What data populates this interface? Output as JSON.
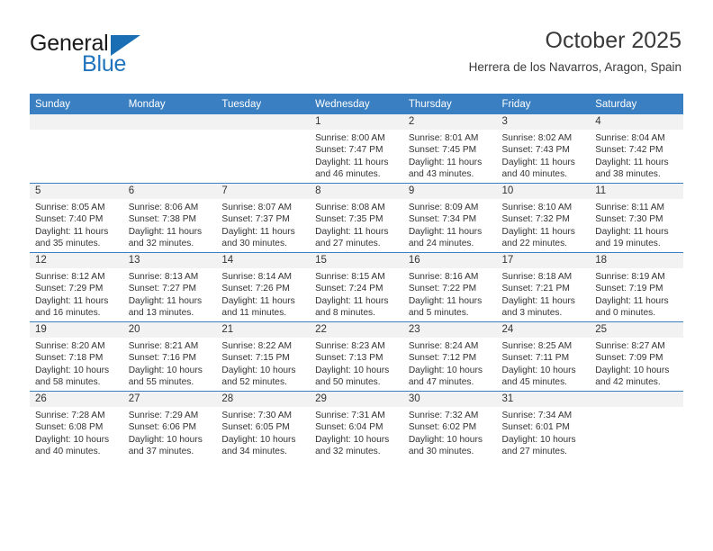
{
  "brand": {
    "name_part1": "General",
    "name_part2": "Blue",
    "accent_color": "#1a6fb4"
  },
  "header": {
    "title": "October 2025",
    "subtitle": "Herrera de los Navarros, Aragon, Spain"
  },
  "calendar": {
    "header_bg": "#3a7fc1",
    "daynum_bg": "#f2f2f2",
    "weekday_headers": [
      "Sunday",
      "Monday",
      "Tuesday",
      "Wednesday",
      "Thursday",
      "Friday",
      "Saturday"
    ],
    "weeks": [
      [
        {
          "day": "",
          "sunrise": "",
          "sunset": "",
          "daylight": "",
          "empty": true
        },
        {
          "day": "",
          "sunrise": "",
          "sunset": "",
          "daylight": "",
          "empty": true
        },
        {
          "day": "",
          "sunrise": "",
          "sunset": "",
          "daylight": "",
          "empty": true
        },
        {
          "day": "1",
          "sunrise": "Sunrise: 8:00 AM",
          "sunset": "Sunset: 7:47 PM",
          "daylight": "Daylight: 11 hours and 46 minutes.",
          "empty": false
        },
        {
          "day": "2",
          "sunrise": "Sunrise: 8:01 AM",
          "sunset": "Sunset: 7:45 PM",
          "daylight": "Daylight: 11 hours and 43 minutes.",
          "empty": false
        },
        {
          "day": "3",
          "sunrise": "Sunrise: 8:02 AM",
          "sunset": "Sunset: 7:43 PM",
          "daylight": "Daylight: 11 hours and 40 minutes.",
          "empty": false
        },
        {
          "day": "4",
          "sunrise": "Sunrise: 8:04 AM",
          "sunset": "Sunset: 7:42 PM",
          "daylight": "Daylight: 11 hours and 38 minutes.",
          "empty": false
        }
      ],
      [
        {
          "day": "5",
          "sunrise": "Sunrise: 8:05 AM",
          "sunset": "Sunset: 7:40 PM",
          "daylight": "Daylight: 11 hours and 35 minutes.",
          "empty": false
        },
        {
          "day": "6",
          "sunrise": "Sunrise: 8:06 AM",
          "sunset": "Sunset: 7:38 PM",
          "daylight": "Daylight: 11 hours and 32 minutes.",
          "empty": false
        },
        {
          "day": "7",
          "sunrise": "Sunrise: 8:07 AM",
          "sunset": "Sunset: 7:37 PM",
          "daylight": "Daylight: 11 hours and 30 minutes.",
          "empty": false
        },
        {
          "day": "8",
          "sunrise": "Sunrise: 8:08 AM",
          "sunset": "Sunset: 7:35 PM",
          "daylight": "Daylight: 11 hours and 27 minutes.",
          "empty": false
        },
        {
          "day": "9",
          "sunrise": "Sunrise: 8:09 AM",
          "sunset": "Sunset: 7:34 PM",
          "daylight": "Daylight: 11 hours and 24 minutes.",
          "empty": false
        },
        {
          "day": "10",
          "sunrise": "Sunrise: 8:10 AM",
          "sunset": "Sunset: 7:32 PM",
          "daylight": "Daylight: 11 hours and 22 minutes.",
          "empty": false
        },
        {
          "day": "11",
          "sunrise": "Sunrise: 8:11 AM",
          "sunset": "Sunset: 7:30 PM",
          "daylight": "Daylight: 11 hours and 19 minutes.",
          "empty": false
        }
      ],
      [
        {
          "day": "12",
          "sunrise": "Sunrise: 8:12 AM",
          "sunset": "Sunset: 7:29 PM",
          "daylight": "Daylight: 11 hours and 16 minutes.",
          "empty": false
        },
        {
          "day": "13",
          "sunrise": "Sunrise: 8:13 AM",
          "sunset": "Sunset: 7:27 PM",
          "daylight": "Daylight: 11 hours and 13 minutes.",
          "empty": false
        },
        {
          "day": "14",
          "sunrise": "Sunrise: 8:14 AM",
          "sunset": "Sunset: 7:26 PM",
          "daylight": "Daylight: 11 hours and 11 minutes.",
          "empty": false
        },
        {
          "day": "15",
          "sunrise": "Sunrise: 8:15 AM",
          "sunset": "Sunset: 7:24 PM",
          "daylight": "Daylight: 11 hours and 8 minutes.",
          "empty": false
        },
        {
          "day": "16",
          "sunrise": "Sunrise: 8:16 AM",
          "sunset": "Sunset: 7:22 PM",
          "daylight": "Daylight: 11 hours and 5 minutes.",
          "empty": false
        },
        {
          "day": "17",
          "sunrise": "Sunrise: 8:18 AM",
          "sunset": "Sunset: 7:21 PM",
          "daylight": "Daylight: 11 hours and 3 minutes.",
          "empty": false
        },
        {
          "day": "18",
          "sunrise": "Sunrise: 8:19 AM",
          "sunset": "Sunset: 7:19 PM",
          "daylight": "Daylight: 11 hours and 0 minutes.",
          "empty": false
        }
      ],
      [
        {
          "day": "19",
          "sunrise": "Sunrise: 8:20 AM",
          "sunset": "Sunset: 7:18 PM",
          "daylight": "Daylight: 10 hours and 58 minutes.",
          "empty": false
        },
        {
          "day": "20",
          "sunrise": "Sunrise: 8:21 AM",
          "sunset": "Sunset: 7:16 PM",
          "daylight": "Daylight: 10 hours and 55 minutes.",
          "empty": false
        },
        {
          "day": "21",
          "sunrise": "Sunrise: 8:22 AM",
          "sunset": "Sunset: 7:15 PM",
          "daylight": "Daylight: 10 hours and 52 minutes.",
          "empty": false
        },
        {
          "day": "22",
          "sunrise": "Sunrise: 8:23 AM",
          "sunset": "Sunset: 7:13 PM",
          "daylight": "Daylight: 10 hours and 50 minutes.",
          "empty": false
        },
        {
          "day": "23",
          "sunrise": "Sunrise: 8:24 AM",
          "sunset": "Sunset: 7:12 PM",
          "daylight": "Daylight: 10 hours and 47 minutes.",
          "empty": false
        },
        {
          "day": "24",
          "sunrise": "Sunrise: 8:25 AM",
          "sunset": "Sunset: 7:11 PM",
          "daylight": "Daylight: 10 hours and 45 minutes.",
          "empty": false
        },
        {
          "day": "25",
          "sunrise": "Sunrise: 8:27 AM",
          "sunset": "Sunset: 7:09 PM",
          "daylight": "Daylight: 10 hours and 42 minutes.",
          "empty": false
        }
      ],
      [
        {
          "day": "26",
          "sunrise": "Sunrise: 7:28 AM",
          "sunset": "Sunset: 6:08 PM",
          "daylight": "Daylight: 10 hours and 40 minutes.",
          "empty": false
        },
        {
          "day": "27",
          "sunrise": "Sunrise: 7:29 AM",
          "sunset": "Sunset: 6:06 PM",
          "daylight": "Daylight: 10 hours and 37 minutes.",
          "empty": false
        },
        {
          "day": "28",
          "sunrise": "Sunrise: 7:30 AM",
          "sunset": "Sunset: 6:05 PM",
          "daylight": "Daylight: 10 hours and 34 minutes.",
          "empty": false
        },
        {
          "day": "29",
          "sunrise": "Sunrise: 7:31 AM",
          "sunset": "Sunset: 6:04 PM",
          "daylight": "Daylight: 10 hours and 32 minutes.",
          "empty": false
        },
        {
          "day": "30",
          "sunrise": "Sunrise: 7:32 AM",
          "sunset": "Sunset: 6:02 PM",
          "daylight": "Daylight: 10 hours and 30 minutes.",
          "empty": false
        },
        {
          "day": "31",
          "sunrise": "Sunrise: 7:34 AM",
          "sunset": "Sunset: 6:01 PM",
          "daylight": "Daylight: 10 hours and 27 minutes.",
          "empty": false
        },
        {
          "day": "",
          "sunrise": "",
          "sunset": "",
          "daylight": "",
          "empty": true
        }
      ]
    ]
  }
}
